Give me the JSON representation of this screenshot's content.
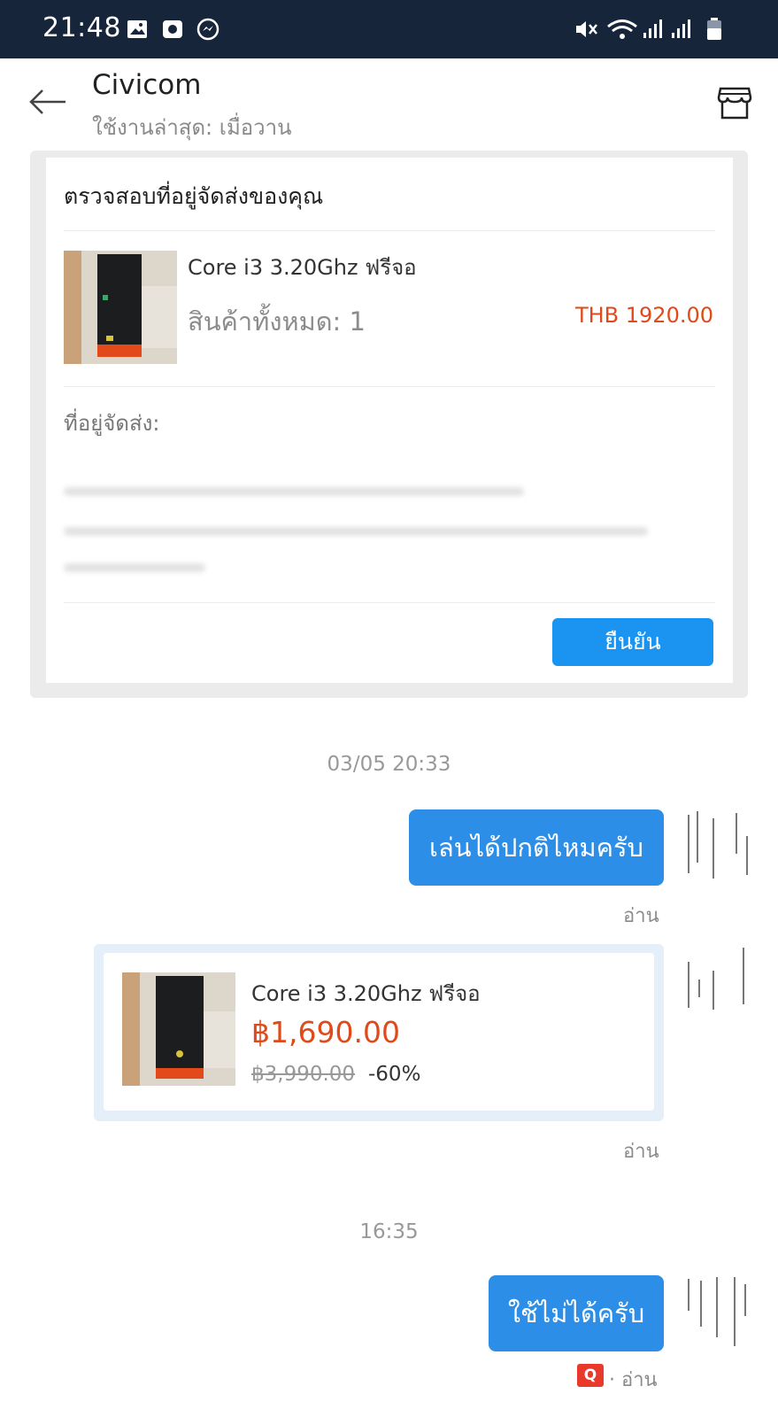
{
  "status_bar": {
    "time": "21:48"
  },
  "header": {
    "title": "Civicom",
    "subtitle": "ใช้งานล่าสุด: เมื่อวาน"
  },
  "address_card": {
    "heading": "ตรวจสอบที่อยู่จัดส่งของคุณ",
    "product_name": "Core i3 3.20Ghz ฟรีจอ",
    "quantity": "สินค้าทั้งหมด: 1",
    "total": "THB 1920.00",
    "address_label": "ที่อยู่จัดส่ง:",
    "confirm_label": "ยืนยัน"
  },
  "messages": [
    {
      "timestamp": "03/05 20:33",
      "text": "เล่นได้ปกติไหมครับ",
      "status": "อ่าน"
    },
    {
      "product_name": "Core i3 3.20Ghz ฟรีจอ",
      "price": "฿1,690.00",
      "original_price": "฿3,990.00",
      "discount": "-60%",
      "status": "อ่าน"
    },
    {
      "timestamp": "16:35",
      "text": "ใช้ไม่ได้ครับ",
      "status": "· อ่าน",
      "badge": "Q"
    }
  ],
  "colors": {
    "accent": "#1a94f0",
    "bubble": "#2d8ee8",
    "price": "#e04a1a",
    "status_bar": "#16253a"
  }
}
